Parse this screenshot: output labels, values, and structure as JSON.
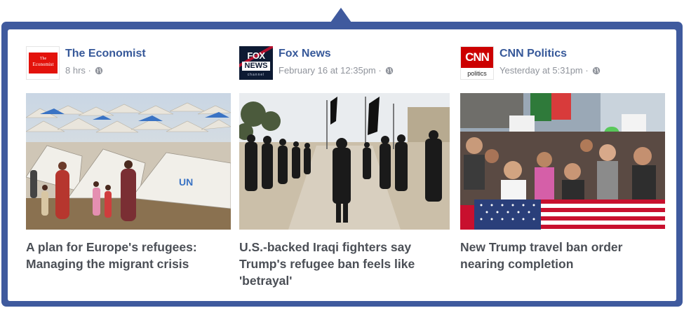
{
  "colors": {
    "frame": "#3f5a9e",
    "source_link": "#365899",
    "meta_text": "#90949c",
    "headline_text": "#4b4f56"
  },
  "cards": [
    {
      "logo_icon": "the-economist-logo",
      "logo_text": {
        "the": "The",
        "name": "Economist"
      },
      "source": "The Economist",
      "time": "8 hrs ·",
      "privacy_icon": "globe-icon",
      "image_icon": "refugee-camp-photo",
      "headline": "A plan for Europe's refugees: Managing the migrant crisis"
    },
    {
      "logo_icon": "fox-news-logo",
      "logo_text": {
        "top": "FOX",
        "bottom": "NEWS",
        "channel": "channel"
      },
      "source": "Fox News",
      "time": "February 16 at 12:35pm ·",
      "privacy_icon": "globe-icon",
      "image_icon": "fighters-march-photo",
      "headline": "U.S.-backed Iraqi fighters say Trump's refugee ban feels like 'betrayal'"
    },
    {
      "logo_icon": "cnn-politics-logo",
      "logo_text": {
        "top": "CNN",
        "bottom": "politics"
      },
      "source": "CNN Politics",
      "time": "Yesterday at 5:31pm ·",
      "privacy_icon": "globe-icon",
      "image_icon": "protest-crowd-photo",
      "headline": "New Trump travel ban order nearing completion"
    }
  ]
}
